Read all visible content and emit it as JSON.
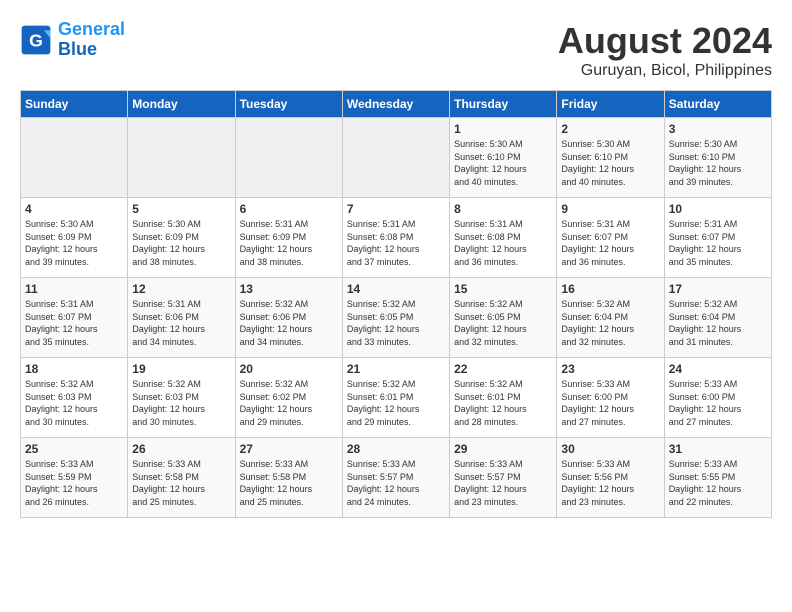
{
  "logo": {
    "line1": "General",
    "line2": "Blue"
  },
  "title": "August 2024",
  "subtitle": "Guruyan, Bicol, Philippines",
  "weekdays": [
    "Sunday",
    "Monday",
    "Tuesday",
    "Wednesday",
    "Thursday",
    "Friday",
    "Saturday"
  ],
  "weeks": [
    [
      {
        "day": "",
        "info": ""
      },
      {
        "day": "",
        "info": ""
      },
      {
        "day": "",
        "info": ""
      },
      {
        "day": "",
        "info": ""
      },
      {
        "day": "1",
        "info": "Sunrise: 5:30 AM\nSunset: 6:10 PM\nDaylight: 12 hours\nand 40 minutes."
      },
      {
        "day": "2",
        "info": "Sunrise: 5:30 AM\nSunset: 6:10 PM\nDaylight: 12 hours\nand 40 minutes."
      },
      {
        "day": "3",
        "info": "Sunrise: 5:30 AM\nSunset: 6:10 PM\nDaylight: 12 hours\nand 39 minutes."
      }
    ],
    [
      {
        "day": "4",
        "info": "Sunrise: 5:30 AM\nSunset: 6:09 PM\nDaylight: 12 hours\nand 39 minutes."
      },
      {
        "day": "5",
        "info": "Sunrise: 5:30 AM\nSunset: 6:09 PM\nDaylight: 12 hours\nand 38 minutes."
      },
      {
        "day": "6",
        "info": "Sunrise: 5:31 AM\nSunset: 6:09 PM\nDaylight: 12 hours\nand 38 minutes."
      },
      {
        "day": "7",
        "info": "Sunrise: 5:31 AM\nSunset: 6:08 PM\nDaylight: 12 hours\nand 37 minutes."
      },
      {
        "day": "8",
        "info": "Sunrise: 5:31 AM\nSunset: 6:08 PM\nDaylight: 12 hours\nand 36 minutes."
      },
      {
        "day": "9",
        "info": "Sunrise: 5:31 AM\nSunset: 6:07 PM\nDaylight: 12 hours\nand 36 minutes."
      },
      {
        "day": "10",
        "info": "Sunrise: 5:31 AM\nSunset: 6:07 PM\nDaylight: 12 hours\nand 35 minutes."
      }
    ],
    [
      {
        "day": "11",
        "info": "Sunrise: 5:31 AM\nSunset: 6:07 PM\nDaylight: 12 hours\nand 35 minutes."
      },
      {
        "day": "12",
        "info": "Sunrise: 5:31 AM\nSunset: 6:06 PM\nDaylight: 12 hours\nand 34 minutes."
      },
      {
        "day": "13",
        "info": "Sunrise: 5:32 AM\nSunset: 6:06 PM\nDaylight: 12 hours\nand 34 minutes."
      },
      {
        "day": "14",
        "info": "Sunrise: 5:32 AM\nSunset: 6:05 PM\nDaylight: 12 hours\nand 33 minutes."
      },
      {
        "day": "15",
        "info": "Sunrise: 5:32 AM\nSunset: 6:05 PM\nDaylight: 12 hours\nand 32 minutes."
      },
      {
        "day": "16",
        "info": "Sunrise: 5:32 AM\nSunset: 6:04 PM\nDaylight: 12 hours\nand 32 minutes."
      },
      {
        "day": "17",
        "info": "Sunrise: 5:32 AM\nSunset: 6:04 PM\nDaylight: 12 hours\nand 31 minutes."
      }
    ],
    [
      {
        "day": "18",
        "info": "Sunrise: 5:32 AM\nSunset: 6:03 PM\nDaylight: 12 hours\nand 30 minutes."
      },
      {
        "day": "19",
        "info": "Sunrise: 5:32 AM\nSunset: 6:03 PM\nDaylight: 12 hours\nand 30 minutes."
      },
      {
        "day": "20",
        "info": "Sunrise: 5:32 AM\nSunset: 6:02 PM\nDaylight: 12 hours\nand 29 minutes."
      },
      {
        "day": "21",
        "info": "Sunrise: 5:32 AM\nSunset: 6:01 PM\nDaylight: 12 hours\nand 29 minutes."
      },
      {
        "day": "22",
        "info": "Sunrise: 5:32 AM\nSunset: 6:01 PM\nDaylight: 12 hours\nand 28 minutes."
      },
      {
        "day": "23",
        "info": "Sunrise: 5:33 AM\nSunset: 6:00 PM\nDaylight: 12 hours\nand 27 minutes."
      },
      {
        "day": "24",
        "info": "Sunrise: 5:33 AM\nSunset: 6:00 PM\nDaylight: 12 hours\nand 27 minutes."
      }
    ],
    [
      {
        "day": "25",
        "info": "Sunrise: 5:33 AM\nSunset: 5:59 PM\nDaylight: 12 hours\nand 26 minutes."
      },
      {
        "day": "26",
        "info": "Sunrise: 5:33 AM\nSunset: 5:58 PM\nDaylight: 12 hours\nand 25 minutes."
      },
      {
        "day": "27",
        "info": "Sunrise: 5:33 AM\nSunset: 5:58 PM\nDaylight: 12 hours\nand 25 minutes."
      },
      {
        "day": "28",
        "info": "Sunrise: 5:33 AM\nSunset: 5:57 PM\nDaylight: 12 hours\nand 24 minutes."
      },
      {
        "day": "29",
        "info": "Sunrise: 5:33 AM\nSunset: 5:57 PM\nDaylight: 12 hours\nand 23 minutes."
      },
      {
        "day": "30",
        "info": "Sunrise: 5:33 AM\nSunset: 5:56 PM\nDaylight: 12 hours\nand 23 minutes."
      },
      {
        "day": "31",
        "info": "Sunrise: 5:33 AM\nSunset: 5:55 PM\nDaylight: 12 hours\nand 22 minutes."
      }
    ]
  ]
}
